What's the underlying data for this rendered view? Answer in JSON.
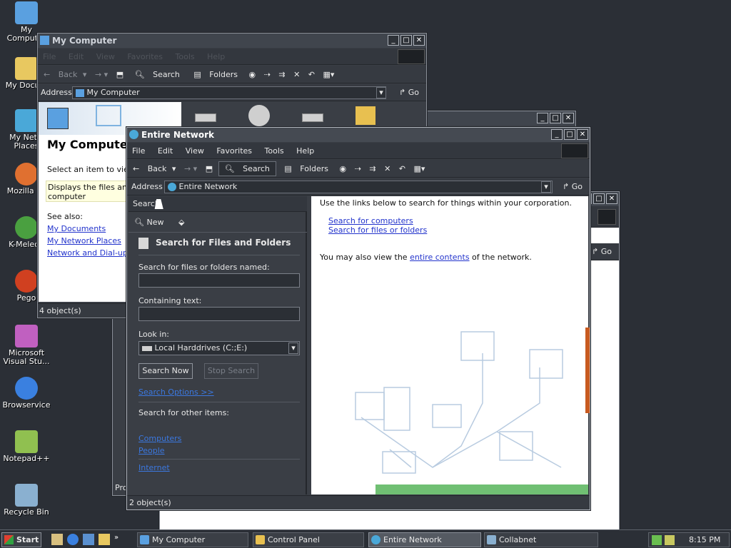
{
  "desktop": {
    "icons": [
      {
        "label": "My Computer",
        "icon": "my-computer-icon",
        "color": "#5aa0e0"
      },
      {
        "label": "My Docum",
        "icon": "folder-icon",
        "color": "#e8c860"
      },
      {
        "label": "My Netw Places",
        "icon": "network-places-icon",
        "color": "#4aa8d8"
      },
      {
        "label": "Mozilla Fir",
        "icon": "firefox-icon",
        "color": "#e07030"
      },
      {
        "label": "K-Meleon",
        "icon": "k-meleon-icon",
        "color": "#4aa040"
      },
      {
        "label": "Pego",
        "icon": "pegasus-icon",
        "color": "#d04020"
      },
      {
        "label": "Microsoft Visual Stu...",
        "icon": "visual-studio-icon",
        "color": "#c060c0"
      },
      {
        "label": "Browservice",
        "icon": "ie-icon",
        "color": "#3a80e0"
      },
      {
        "label": "Notepad++",
        "icon": "notepad-icon",
        "color": "#90c050"
      },
      {
        "label": "Recycle Bin",
        "icon": "recycle-bin-icon",
        "color": "#8ab0d0"
      }
    ]
  },
  "my_computer": {
    "title": "My Computer",
    "menu": [
      "File",
      "Edit",
      "View",
      "Favorites",
      "Tools",
      "Help"
    ],
    "toolbar": {
      "back": "Back",
      "search": "Search",
      "folders": "Folders"
    },
    "address_label": "Address",
    "address_value": "My Computer",
    "go": "Go",
    "heading": "My Computer",
    "hint": "Select an item to view i",
    "info": "Displays the files and fo computer",
    "see_also": "See also:",
    "links": [
      "My Documents",
      "My Network Places",
      "Network and Dial-up Co"
    ],
    "status": "4 object(s)"
  },
  "entire_network": {
    "title": "Entire Network",
    "menu": [
      "File",
      "Edit",
      "View",
      "Favorites",
      "Tools",
      "Help"
    ],
    "toolbar": {
      "back": "Back",
      "search": "Search",
      "folders": "Folders"
    },
    "address_label": "Address",
    "address_value": "Entire Network",
    "go": "Go",
    "search_pane": {
      "header": "Search",
      "new": "New",
      "title": "Search for Files and Folders",
      "named_label": "Search for files or folders named:",
      "named_value": "",
      "containing_label": "Containing text:",
      "containing_value": "",
      "look_in_label": "Look in:",
      "look_in_value": "Local Harddrives (C:;E:)",
      "search_now": "Search Now",
      "stop_search": "Stop Search",
      "options": "Search Options >>",
      "other_label": "Search for other items:",
      "other_items": [
        "Computers",
        "People",
        "Internet"
      ]
    },
    "content": {
      "intro": "Use the links below to search for things within your corporation.",
      "links": [
        "Search for computers",
        "Search for files or folders"
      ],
      "also_pre": "You may also view the ",
      "also_link": "entire contents",
      "also_post": " of the network."
    },
    "status": "2 object(s)"
  },
  "back_window": {
    "go": "Go",
    "status": "Pro"
  },
  "taskbar": {
    "start": "Start",
    "tasks": [
      {
        "label": "My Computer",
        "icon": "my-computer-icon"
      },
      {
        "label": "Control Panel",
        "icon": "control-panel-icon"
      },
      {
        "label": "Entire Network",
        "icon": "network-icon"
      },
      {
        "label": "Collabnet",
        "icon": "network-icon"
      }
    ],
    "clock": "8:15 PM"
  },
  "colors": {
    "accent_orange": "#c85a20",
    "green_band": "#4caf50"
  }
}
